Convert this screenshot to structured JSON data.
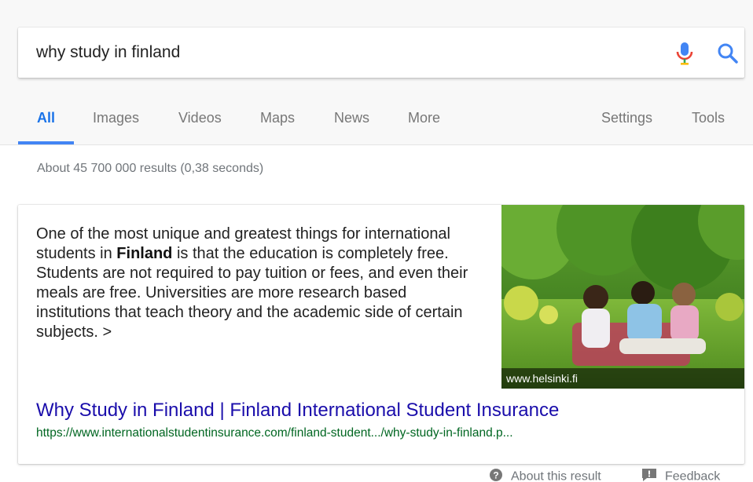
{
  "search": {
    "query": "why study in finland"
  },
  "tabs": [
    {
      "label": "All",
      "active": true
    },
    {
      "label": "Images"
    },
    {
      "label": "Videos"
    },
    {
      "label": "Maps"
    },
    {
      "label": "News"
    },
    {
      "label": "More"
    },
    {
      "label": "Settings"
    },
    {
      "label": "Tools"
    }
  ],
  "stats": "About 45 700 000 results (0,38 seconds)",
  "featured": {
    "snippet_before": "One of the most unique and greatest things for international students in ",
    "snippet_bold": "Finland",
    "snippet_after": " is that the education is completely free. Students are not required to pay tuition or fees, and even their meals are free. Universities are more research based institutions that teach theory and the academic side of certain subjects. >",
    "image_caption": "www.helsinki.fi",
    "title": "Why Study in Finland | Finland International Student Insurance",
    "url": "https://www.internationalstudentinsurance.com/finland-student.../why-study-in-finland.p..."
  },
  "footer": {
    "about": "About this result",
    "feedback": "Feedback"
  },
  "colors": {
    "link": "#1a0dab",
    "url": "#006621",
    "accent": "#4285f4"
  }
}
